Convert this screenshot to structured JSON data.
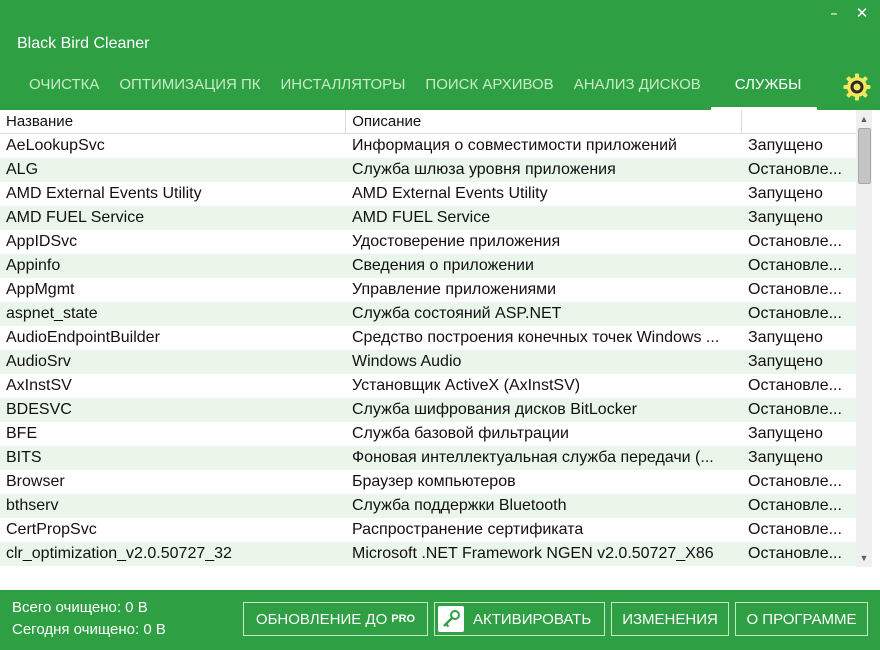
{
  "window": {
    "title": "Black Bird Cleaner",
    "minimize_glyph": "–",
    "close_glyph": "✕"
  },
  "tabs": [
    {
      "label": "ОЧИСТКА",
      "active": false
    },
    {
      "label": "ОПТИМИЗАЦИЯ ПК",
      "active": false
    },
    {
      "label": "ИНСТАЛЛЯТОРЫ",
      "active": false
    },
    {
      "label": "ПОИСК АРХИВОВ",
      "active": false
    },
    {
      "label": "АНАЛИЗ ДИСКОВ",
      "active": false
    },
    {
      "label": "СЛУЖБЫ",
      "active": true
    }
  ],
  "table": {
    "columns": [
      "Название",
      "Описание",
      ""
    ],
    "rows": [
      {
        "name": "AeLookupSvc",
        "description": "Информация о совместимости приложений",
        "status": "Запущено"
      },
      {
        "name": "ALG",
        "description": "Служба шлюза уровня приложения",
        "status": "Остановле..."
      },
      {
        "name": "AMD External Events Utility",
        "description": "AMD External Events Utility",
        "status": "Запущено"
      },
      {
        "name": "AMD FUEL Service",
        "description": "AMD FUEL Service",
        "status": "Запущено"
      },
      {
        "name": "AppIDSvc",
        "description": "Удостоверение приложения",
        "status": "Остановле..."
      },
      {
        "name": "Appinfo",
        "description": "Сведения о приложении",
        "status": "Остановле..."
      },
      {
        "name": "AppMgmt",
        "description": "Управление приложениями",
        "status": "Остановле..."
      },
      {
        "name": "aspnet_state",
        "description": "Служба состояний ASP.NET",
        "status": "Остановле..."
      },
      {
        "name": "AudioEndpointBuilder",
        "description": "Средство построения конечных точек Windows ...",
        "status": "Запущено"
      },
      {
        "name": "AudioSrv",
        "description": "Windows Audio",
        "status": "Запущено"
      },
      {
        "name": "AxInstSV",
        "description": "Установщик ActiveX (AxInstSV)",
        "status": "Остановле..."
      },
      {
        "name": "BDESVC",
        "description": "Служба шифрования дисков BitLocker",
        "status": "Остановле..."
      },
      {
        "name": "BFE",
        "description": "Служба базовой фильтрации",
        "status": "Запущено"
      },
      {
        "name": "BITS",
        "description": "Фоновая интеллектуальная служба передачи (...",
        "status": "Запущено"
      },
      {
        "name": "Browser",
        "description": "Браузер компьютеров",
        "status": "Остановле..."
      },
      {
        "name": "bthserv",
        "description": "Служба поддержки Bluetooth",
        "status": "Остановле..."
      },
      {
        "name": "CertPropSvc",
        "description": "Распространение сертификата",
        "status": "Остановле..."
      },
      {
        "name": "clr_optimization_v2.0.50727_32",
        "description": "Microsoft .NET Framework NGEN v2.0.50727_X86",
        "status": "Остановле..."
      }
    ]
  },
  "footer": {
    "total_cleaned": "Всего очищено: 0 B",
    "today_cleaned": "Сегодня очищено: 0 B",
    "buttons": {
      "upgrade": "ОБНОВЛЕНИЕ ДО",
      "upgrade_pro": "PRO",
      "activate": "АКТИВИРОВАТЬ",
      "changes": "ИЗМЕНЕНИЯ",
      "about": "О ПРОГРАММЕ"
    }
  },
  "icons": {
    "settings": "gear-icon",
    "activate": "key-icon"
  },
  "colors": {
    "brand_green": "#2ea043",
    "row_alt": "#eaf6ea",
    "gear_yellow": "#f2e85a"
  }
}
